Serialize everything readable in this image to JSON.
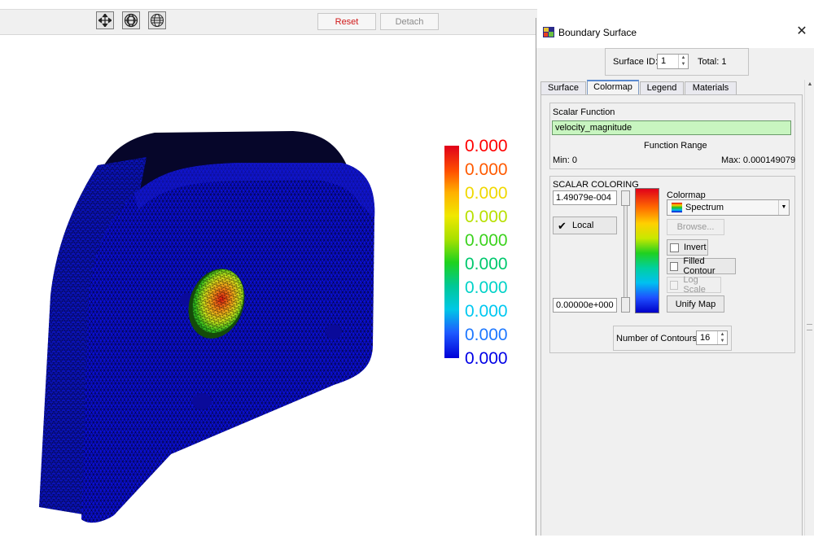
{
  "toolbar": {
    "reset_label": "Reset",
    "detach_label": "Detach",
    "icons": [
      "move-arrows-icon",
      "globe-icon",
      "grid-globe-icon"
    ]
  },
  "legend": {
    "values": [
      "0.000",
      "0.000",
      "0.000",
      "0.000",
      "0.000",
      "0.000",
      "0.000",
      "0.000",
      "0.000",
      "0.000"
    ],
    "colors": [
      "#ff0000",
      "#ff5a00",
      "#f0d800",
      "#b8e000",
      "#3cd21e",
      "#00c86e",
      "#00d2c8",
      "#00c8f0",
      "#1e78ff",
      "#0000e6"
    ]
  },
  "dialog": {
    "title": "Boundary Surface",
    "surface_id_label": "Surface ID:",
    "surface_id_value": "1",
    "total_label": "Total: 1",
    "tabs": [
      {
        "label": "Surface",
        "active": false
      },
      {
        "label": "Colormap",
        "active": true
      },
      {
        "label": "Legend",
        "active": false
      },
      {
        "label": "Materials",
        "active": false
      }
    ],
    "scalar_function": {
      "heading": "Scalar Function",
      "value": "velocity_magnitude",
      "range_label": "Function Range",
      "min_label": "Min:  0",
      "max_label": "Max:  0.000149079"
    },
    "scalar_coloring": {
      "heading": "SCALAR COLORING",
      "max_value": "1.49079e-004",
      "min_value": "0.00000e+000",
      "local_label": "Local",
      "local_checked": true,
      "colormap_label": "Colormap",
      "colormap_selected": "Spectrum",
      "browse_label": "Browse...",
      "invert_label": "Invert",
      "filled_contour_label": "Filled Contour",
      "log_scale_label": "Log Scale",
      "unify_map_label": "Unify Map",
      "contours_label": "Number of Contours:",
      "contours_value": "16"
    }
  }
}
